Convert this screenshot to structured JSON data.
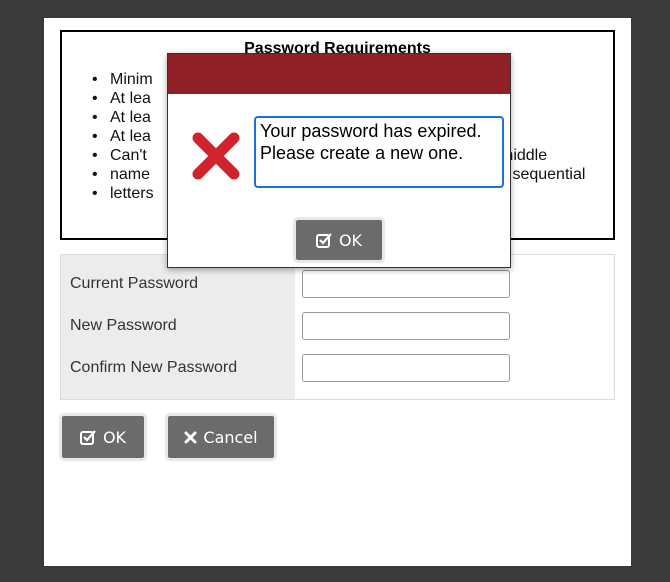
{
  "requirements": {
    "title": "Password Requirements",
    "items": [
      {
        "visible": "Minim",
        "tail": ""
      },
      {
        "visible": "At lea",
        "tail": ""
      },
      {
        "visible": "At lea",
        "tail": ""
      },
      {
        "visible": "At lea",
        "tail": ""
      },
      {
        "visible": "Can't",
        "tail": "middle"
      },
      {
        "visible": "name",
        "tail": "y sequential"
      },
      {
        "visible": "letters",
        "tail": ""
      }
    ]
  },
  "form": {
    "current_password_label": "Current Password",
    "new_password_label": "New Password",
    "confirm_password_label": "Confirm New Password",
    "current_password_value": "",
    "new_password_value": "",
    "confirm_password_value": ""
  },
  "buttons": {
    "ok_label": "OK",
    "cancel_label": "Cancel"
  },
  "modal": {
    "message": "Your password has expired. Please create a new one.",
    "ok_label": "OK",
    "header_color": "#8f2025",
    "error_icon": "error-x-icon",
    "error_color": "#d0232b"
  }
}
